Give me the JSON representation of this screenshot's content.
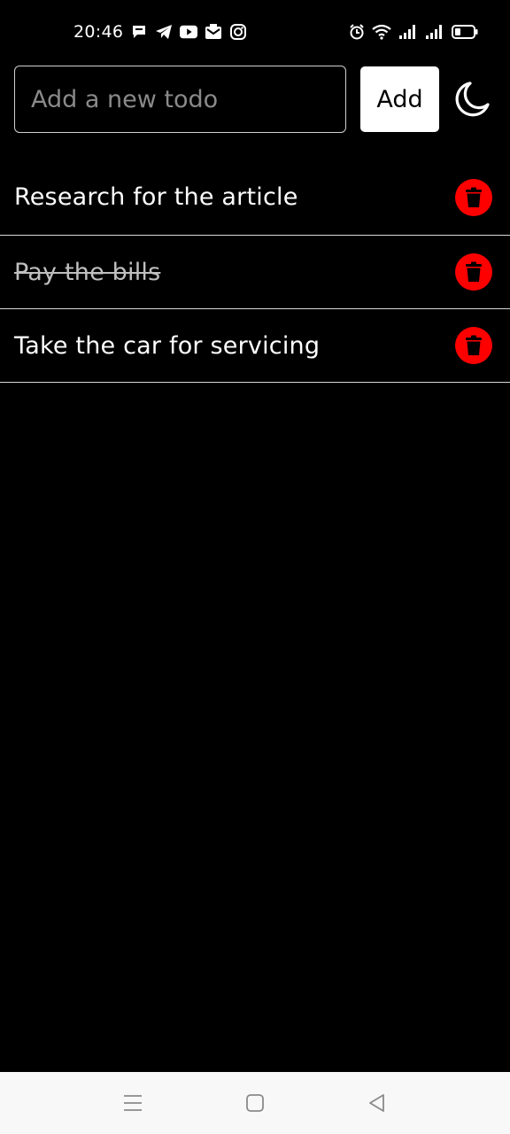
{
  "status_bar": {
    "time": "20:46",
    "notification_icons": [
      "message-icon",
      "telegram-icon",
      "youtube-icon",
      "mail-icon",
      "instagram-icon"
    ],
    "system_icons": [
      "alarm-icon",
      "wifi-icon",
      "signal-icon",
      "signal-icon",
      "battery-icon"
    ]
  },
  "add_row": {
    "input_placeholder": "Add a new todo",
    "input_value": "",
    "add_label": "Add",
    "theme_icon": "moon-icon"
  },
  "todos": [
    {
      "text": "Research for the article",
      "completed": false
    },
    {
      "text": "Pay the bills",
      "completed": true
    },
    {
      "text": "Take the car for servicing",
      "completed": false
    }
  ],
  "colors": {
    "background": "#000000",
    "text": "#ffffff",
    "delete": "#ff0000",
    "divider": "#d9d9d9",
    "nav_bar": "#f8f8f8"
  },
  "nav_bar": {
    "buttons": [
      "menu-icon",
      "home-icon",
      "back-icon"
    ]
  }
}
